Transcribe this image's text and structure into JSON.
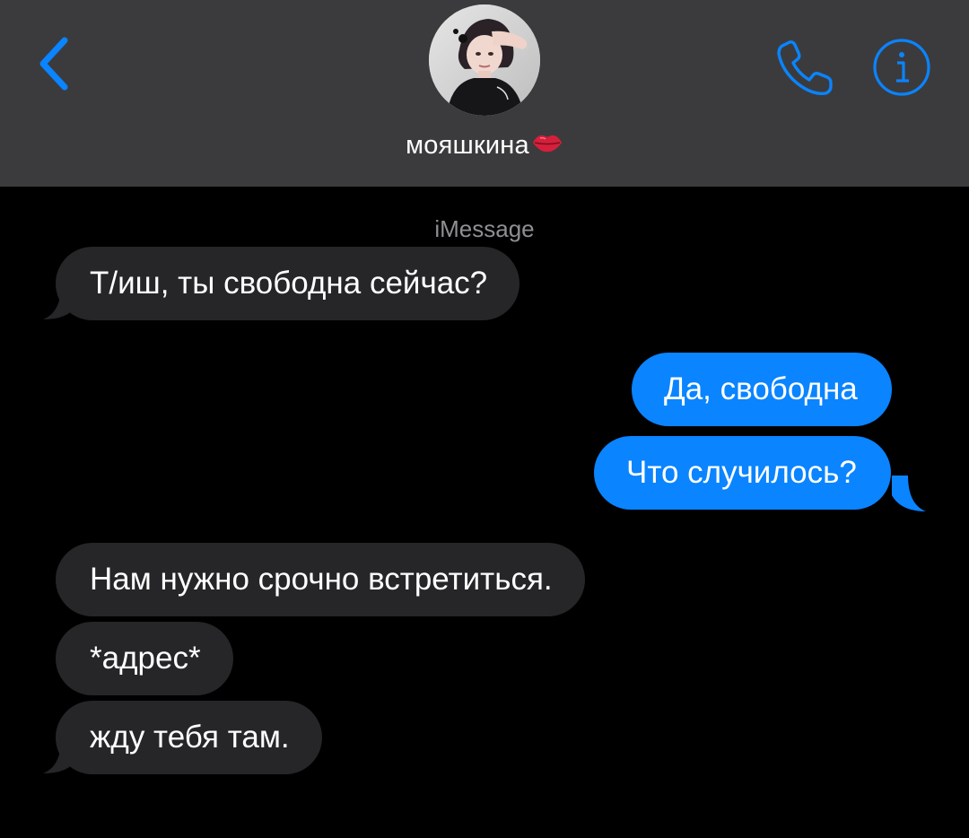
{
  "header": {
    "contact_name": "мояшкина",
    "contact_emoji": "kiss-mark-lips",
    "back_icon": "chevron-left-icon",
    "call_icon": "phone-icon",
    "info_icon": "info-icon",
    "accent_color": "#0a84ff",
    "background_color": "#3b3b3d"
  },
  "thread": {
    "service_label": "iMessage",
    "incoming_color": "#262629",
    "outgoing_color": "#0a84ff",
    "messages": [
      {
        "direction": "incoming",
        "text": "Т/иш, ты свободна сейчас?"
      },
      {
        "direction": "outgoing",
        "text": "Да, свободна"
      },
      {
        "direction": "outgoing",
        "text": "Что случилось?"
      },
      {
        "direction": "incoming",
        "text": "Нам нужно срочно встретиться."
      },
      {
        "direction": "incoming",
        "text": "*адрес*"
      },
      {
        "direction": "incoming",
        "text": "жду тебя там."
      }
    ]
  }
}
